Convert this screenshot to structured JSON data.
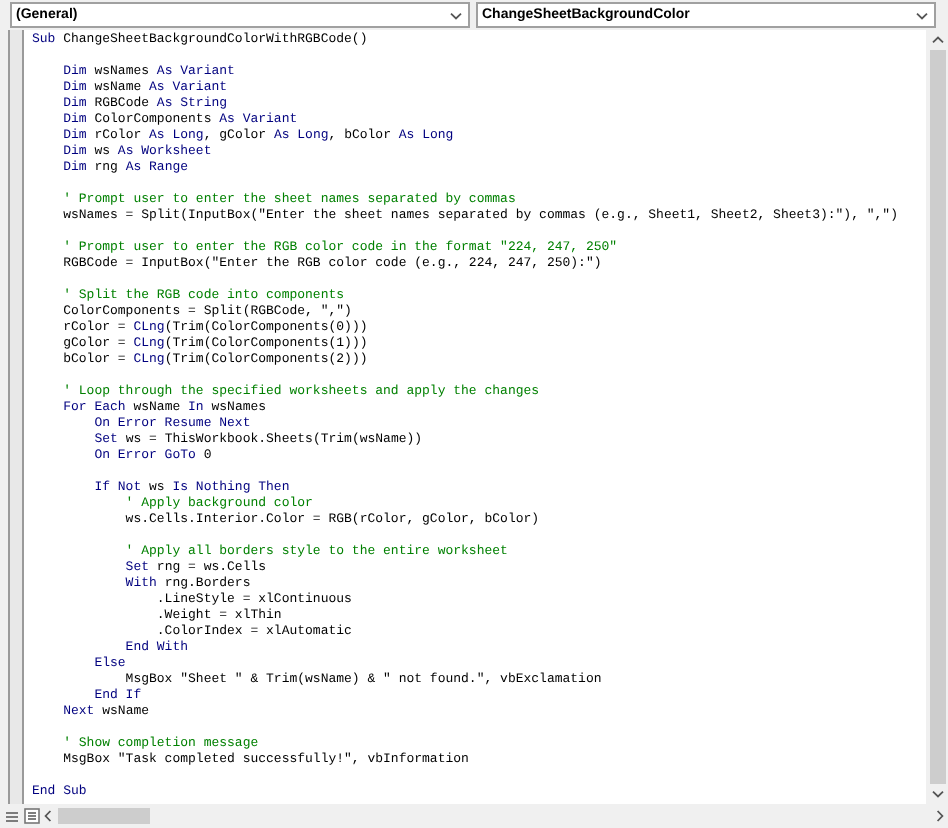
{
  "toolbar": {
    "object_dropdown": {
      "value": "(General)"
    },
    "procedure_dropdown": {
      "value": "ChangeSheetBackgroundColor"
    }
  },
  "code_lines": [
    {
      "kind": "code",
      "segments": [
        {
          "kind": "keyword",
          "text": "Sub"
        },
        {
          "kind": "plain",
          "text": " ChangeSheetBackgroundColorWithRGBCode()"
        }
      ]
    },
    {
      "kind": "blank"
    },
    {
      "kind": "code",
      "segments": [
        {
          "kind": "keyword",
          "text": "    Dim"
        },
        {
          "kind": "plain",
          "text": " wsNames "
        },
        {
          "kind": "keyword",
          "text": "As Variant"
        }
      ]
    },
    {
      "kind": "code",
      "segments": [
        {
          "kind": "keyword",
          "text": "    Dim"
        },
        {
          "kind": "plain",
          "text": " wsName "
        },
        {
          "kind": "keyword",
          "text": "As Variant"
        }
      ]
    },
    {
      "kind": "code",
      "segments": [
        {
          "kind": "keyword",
          "text": "    Dim"
        },
        {
          "kind": "plain",
          "text": " RGBCode "
        },
        {
          "kind": "keyword",
          "text": "As String"
        }
      ]
    },
    {
      "kind": "code",
      "segments": [
        {
          "kind": "keyword",
          "text": "    Dim"
        },
        {
          "kind": "plain",
          "text": " ColorComponents "
        },
        {
          "kind": "keyword",
          "text": "As Variant"
        }
      ]
    },
    {
      "kind": "code",
      "segments": [
        {
          "kind": "keyword",
          "text": "    Dim"
        },
        {
          "kind": "plain",
          "text": " rColor "
        },
        {
          "kind": "keyword",
          "text": "As Long"
        },
        {
          "kind": "plain",
          "text": ", gColor "
        },
        {
          "kind": "keyword",
          "text": "As Long"
        },
        {
          "kind": "plain",
          "text": ", bColor "
        },
        {
          "kind": "keyword",
          "text": "As Long"
        }
      ]
    },
    {
      "kind": "code",
      "segments": [
        {
          "kind": "keyword",
          "text": "    Dim"
        },
        {
          "kind": "plain",
          "text": " ws "
        },
        {
          "kind": "keyword",
          "text": "As Worksheet"
        }
      ]
    },
    {
      "kind": "code",
      "segments": [
        {
          "kind": "keyword",
          "text": "    Dim"
        },
        {
          "kind": "plain",
          "text": " rng "
        },
        {
          "kind": "keyword",
          "text": "As Range"
        }
      ]
    },
    {
      "kind": "blank"
    },
    {
      "kind": "code",
      "segments": [
        {
          "kind": "comment",
          "text": "    ' Prompt user to enter the sheet names separated by commas"
        }
      ]
    },
    {
      "kind": "code",
      "segments": [
        {
          "kind": "plain",
          "text": "    wsNames = Split(InputBox(\"Enter the sheet names separated by commas (e.g., Sheet1, Sheet2, Sheet3):\"), \",\")"
        }
      ]
    },
    {
      "kind": "blank"
    },
    {
      "kind": "code",
      "segments": [
        {
          "kind": "comment",
          "text": "    ' Prompt user to enter the RGB color code in the format \"224, 247, 250\""
        }
      ]
    },
    {
      "kind": "code",
      "segments": [
        {
          "kind": "plain",
          "text": "    RGBCode = InputBox(\"Enter the RGB color code (e.g., 224, 247, 250):\")"
        }
      ]
    },
    {
      "kind": "blank"
    },
    {
      "kind": "code",
      "segments": [
        {
          "kind": "comment",
          "text": "    ' Split the RGB code into components"
        }
      ]
    },
    {
      "kind": "code",
      "segments": [
        {
          "kind": "plain",
          "text": "    ColorComponents = Split(RGBCode, \",\")"
        }
      ]
    },
    {
      "kind": "code",
      "segments": [
        {
          "kind": "plain",
          "text": "    rColor = "
        },
        {
          "kind": "keyword",
          "text": "CLng"
        },
        {
          "kind": "plain",
          "text": "(Trim(ColorComponents(0)))"
        }
      ]
    },
    {
      "kind": "code",
      "segments": [
        {
          "kind": "plain",
          "text": "    gColor = "
        },
        {
          "kind": "keyword",
          "text": "CLng"
        },
        {
          "kind": "plain",
          "text": "(Trim(ColorComponents(1)))"
        }
      ]
    },
    {
      "kind": "code",
      "segments": [
        {
          "kind": "plain",
          "text": "    bColor = "
        },
        {
          "kind": "keyword",
          "text": "CLng"
        },
        {
          "kind": "plain",
          "text": "(Trim(ColorComponents(2)))"
        }
      ]
    },
    {
      "kind": "blank"
    },
    {
      "kind": "code",
      "segments": [
        {
          "kind": "comment",
          "text": "    ' Loop through the specified worksheets and apply the changes"
        }
      ]
    },
    {
      "kind": "code",
      "segments": [
        {
          "kind": "keyword",
          "text": "    For Each"
        },
        {
          "kind": "plain",
          "text": " wsName "
        },
        {
          "kind": "keyword",
          "text": "In"
        },
        {
          "kind": "plain",
          "text": " wsNames"
        }
      ]
    },
    {
      "kind": "code",
      "segments": [
        {
          "kind": "keyword",
          "text": "        On Error Resume Next"
        }
      ]
    },
    {
      "kind": "code",
      "segments": [
        {
          "kind": "keyword",
          "text": "        Set"
        },
        {
          "kind": "plain",
          "text": " ws = ThisWorkbook.Sheets(Trim(wsName))"
        }
      ]
    },
    {
      "kind": "code",
      "segments": [
        {
          "kind": "keyword",
          "text": "        On Error GoTo"
        },
        {
          "kind": "plain",
          "text": " 0"
        }
      ]
    },
    {
      "kind": "blank"
    },
    {
      "kind": "code",
      "segments": [
        {
          "kind": "keyword",
          "text": "        If Not"
        },
        {
          "kind": "plain",
          "text": " ws "
        },
        {
          "kind": "keyword",
          "text": "Is Nothing Then"
        }
      ]
    },
    {
      "kind": "code",
      "segments": [
        {
          "kind": "comment",
          "text": "            ' Apply background color"
        }
      ]
    },
    {
      "kind": "code",
      "segments": [
        {
          "kind": "plain",
          "text": "            ws.Cells.Interior.Color = RGB(rColor, gColor, bColor)"
        }
      ]
    },
    {
      "kind": "blank"
    },
    {
      "kind": "code",
      "segments": [
        {
          "kind": "comment",
          "text": "            ' Apply all borders style to the entire worksheet"
        }
      ]
    },
    {
      "kind": "code",
      "segments": [
        {
          "kind": "keyword",
          "text": "            Set"
        },
        {
          "kind": "plain",
          "text": " rng = ws.Cells"
        }
      ]
    },
    {
      "kind": "code",
      "segments": [
        {
          "kind": "keyword",
          "text": "            With"
        },
        {
          "kind": "plain",
          "text": " rng.Borders"
        }
      ]
    },
    {
      "kind": "code",
      "segments": [
        {
          "kind": "plain",
          "text": "                .LineStyle = xlContinuous"
        }
      ]
    },
    {
      "kind": "code",
      "segments": [
        {
          "kind": "plain",
          "text": "                .Weight = xlThin"
        }
      ]
    },
    {
      "kind": "code",
      "segments": [
        {
          "kind": "plain",
          "text": "                .ColorIndex = xlAutomatic"
        }
      ]
    },
    {
      "kind": "code",
      "segments": [
        {
          "kind": "keyword",
          "text": "            End With"
        }
      ]
    },
    {
      "kind": "code",
      "segments": [
        {
          "kind": "keyword",
          "text": "        Else"
        }
      ]
    },
    {
      "kind": "code",
      "segments": [
        {
          "kind": "plain",
          "text": "            MsgBox \"Sheet \" & Trim(wsName) & \" not found.\", vbExclamation"
        }
      ]
    },
    {
      "kind": "code",
      "segments": [
        {
          "kind": "keyword",
          "text": "        End If"
        }
      ]
    },
    {
      "kind": "code",
      "segments": [
        {
          "kind": "keyword",
          "text": "    Next"
        },
        {
          "kind": "plain",
          "text": " wsName"
        }
      ]
    },
    {
      "kind": "blank"
    },
    {
      "kind": "code",
      "segments": [
        {
          "kind": "comment",
          "text": "    ' Show completion message"
        }
      ]
    },
    {
      "kind": "code",
      "segments": [
        {
          "kind": "plain",
          "text": "    MsgBox \"Task completed successfully!\", vbInformation"
        }
      ]
    },
    {
      "kind": "blank"
    },
    {
      "kind": "code",
      "segments": [
        {
          "kind": "keyword",
          "text": "End Sub"
        }
      ]
    }
  ]
}
